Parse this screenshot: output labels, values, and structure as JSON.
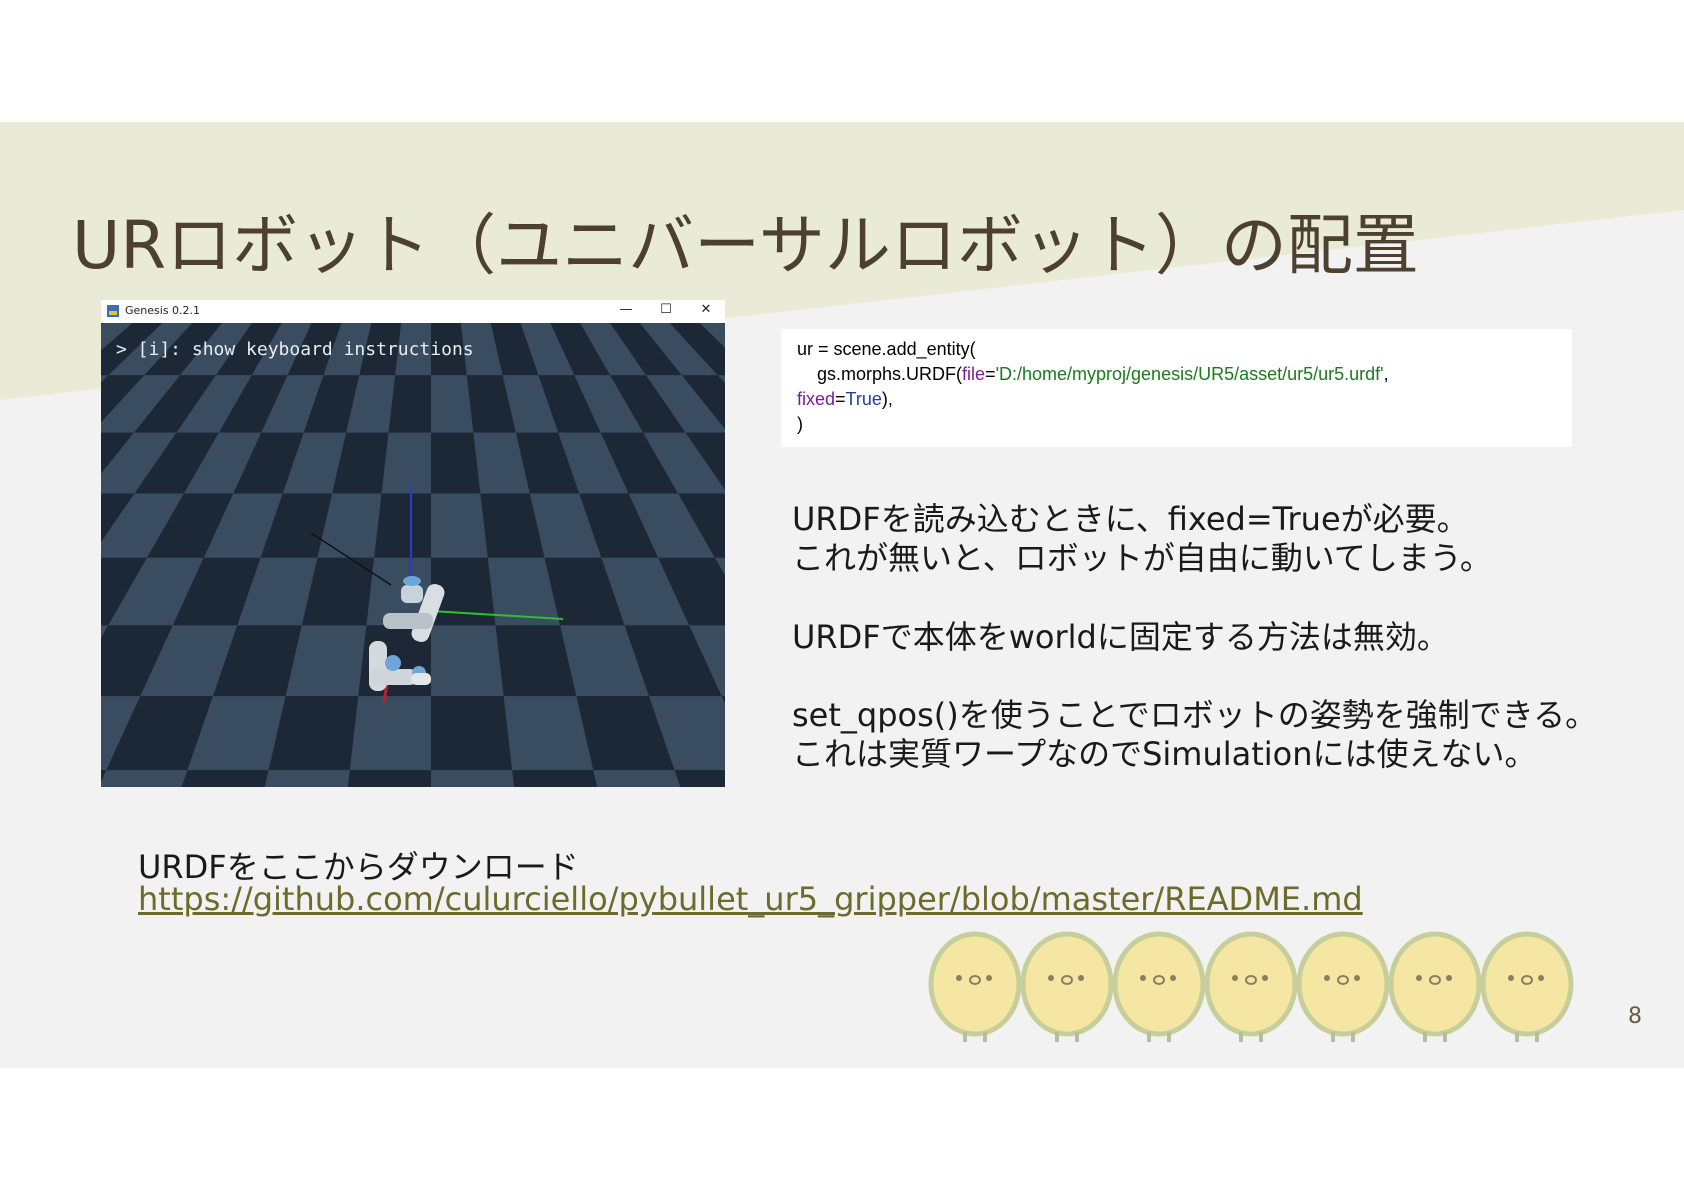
{
  "slide": {
    "title": "URロボット（ユニバーサルロボット）の配置",
    "page_number": "8"
  },
  "window": {
    "title": "Genesis 0.2.1",
    "controls": [
      "—",
      "☐",
      "✕"
    ],
    "console_text": "> [i]: show keyboard instructions"
  },
  "code": {
    "line1": "ur = scene.add_entity(",
    "line2_prefix": "    gs.morphs.URDF(",
    "line2_kw": "file",
    "line2_eq": "=",
    "line2_str": "'D:/home/myproj/genesis/UR5/asset/ur5/ur5.urdf'",
    "line2_suffix": ",",
    "line3_kw": "fixed",
    "line3_eq": "=",
    "line3_const": "True",
    "line3_suffix": "),",
    "line4": ")"
  },
  "notes": {
    "p1_line1": "URDFを読み込むときに、fixed=Trueが必要。",
    "p1_line2": "これが無いと、ロボットが自由に動いてしまう。",
    "p2_line1": "URDFで本体をworldに固定する方法は無効。",
    "p3_line1": "set_qpos()を使うことでロボットの姿勢を強制できる。",
    "p3_line2": "これは実質ワープなのでSimulationには使えない。"
  },
  "download": {
    "label": "URDFをここからダウンロード",
    "link": "https://github.com/culurciello/pybullet_ur5_gripper/blob/master/README.md"
  },
  "colors": {
    "title": "#4e4030",
    "band": "#e9ebd6",
    "background": "#f2f2f2",
    "link": "#6e6a2c"
  }
}
